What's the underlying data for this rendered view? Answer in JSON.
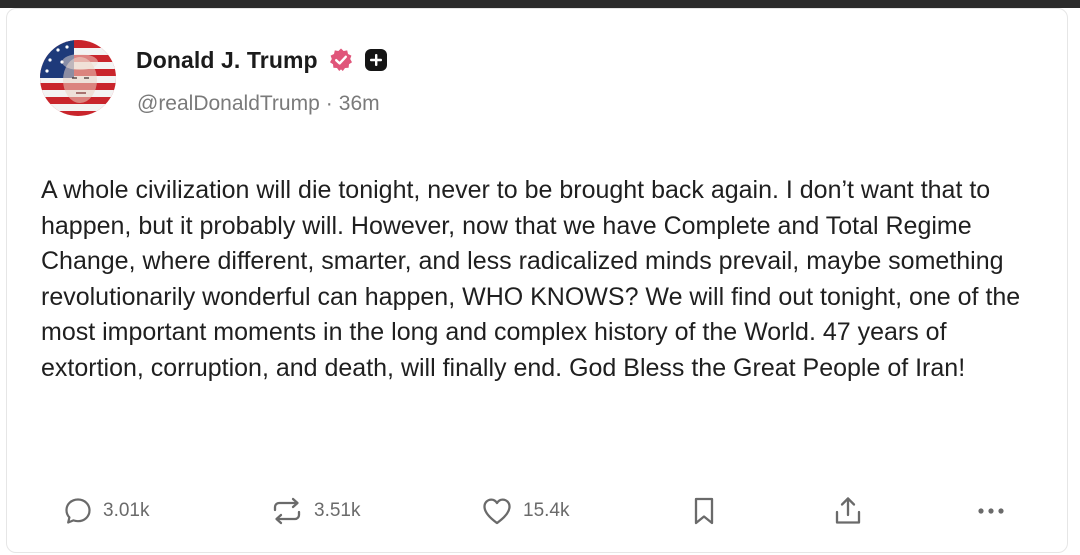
{
  "post": {
    "author_name": "Donald J. Trump",
    "handle": "@realDonaldTrump",
    "separator": "·",
    "time_ago": "36m",
    "text": "A whole civilization will die tonight, never to be brought back again. I don’t want that to happen, but it probably will. However, now that we have Complete and Total Regime Change, where different, smarter, and less radicalized minds prevail, maybe something revolutionarily wonderful can happen, WHO KNOWS? We will find out tonight, one of the most important moments in the long and complex history of the World. 47 years of extortion, corruption, and death, will finally end. God Bless the Great People of Iran!"
  },
  "actions": {
    "replies": "3.01k",
    "reposts": "3.51k",
    "likes": "15.4k"
  },
  "icons": {
    "verified": "verified-badge-icon",
    "plus": "plus-icon",
    "reply": "reply-icon",
    "repost": "repost-icon",
    "like": "heart-icon",
    "bookmark": "bookmark-icon",
    "share": "share-icon",
    "more": "more-icon"
  },
  "colors": {
    "verified_badge": "#e0557a",
    "text": "#1f1f1f",
    "muted": "#7a7a7a"
  }
}
